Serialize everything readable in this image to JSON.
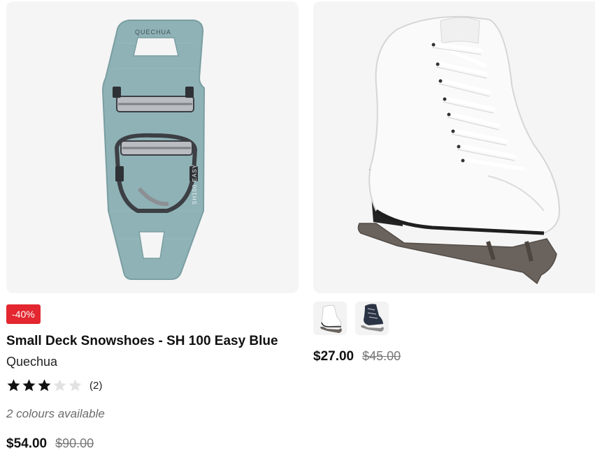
{
  "products": [
    {
      "image_icon": "snowshoe-icon",
      "badge": "-40%",
      "title": "Small Deck Snowshoes - SH 100 Easy Blue",
      "brand": "Quechua",
      "image_brand_mark": "QUECHUA",
      "image_model_mark": "SH100 EASY",
      "rating": {
        "stars": 3,
        "max": 5,
        "count_label": "(2)"
      },
      "colours_label": "2 colours available",
      "price": "$54.00",
      "old_price": "$90.00"
    },
    {
      "image_icon": "ice-skate-icon",
      "thumbnails": [
        {
          "name": "white-skate-thumbnail",
          "color": "#ffffff"
        },
        {
          "name": "navy-skate-thumbnail",
          "color": "#2b3444"
        }
      ],
      "price": "$27.00",
      "old_price": "$45.00"
    }
  ],
  "colors": {
    "badge": "#e3262f",
    "snowshoe": "#8fb2b6",
    "star_filled": "#111111",
    "star_empty": "#e2e2e2"
  }
}
